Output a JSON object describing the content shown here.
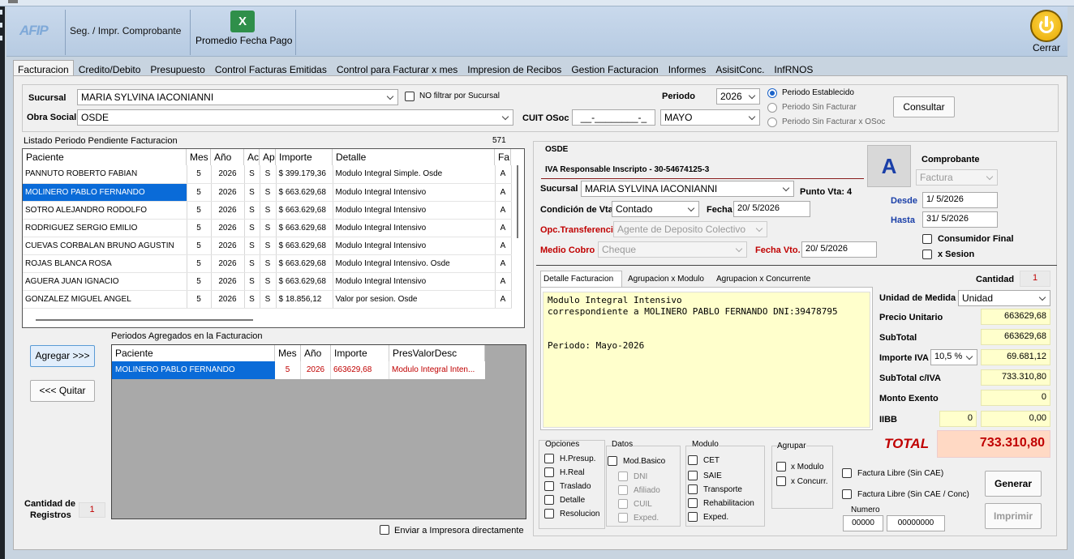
{
  "ribbon": {
    "seg_label": "Seg. / Impr. Comprobante",
    "promedio_label": "Promedio Fecha Pago",
    "cerrar_label": "Cerrar",
    "logo_text": "AFIP",
    "excel_text": "X"
  },
  "tabs": [
    "Facturacion",
    "Credito/Debito",
    "Presupuesto",
    "Control Facturas Emitidas",
    "Control para Facturar x mes",
    "Impresion de Recibos",
    "Gestion Facturacion",
    "Informes",
    "AsisitConc.",
    "InfRNOS"
  ],
  "filter": {
    "sucursal_label": "Sucursal",
    "sucursal_value": "MARIA SYLVINA IACONIANNI",
    "no_filtrar_label": "NO filtrar por Sucursal",
    "obra_social_label": "Obra Social",
    "obra_social_value": "OSDE",
    "cuit_label": "CUIT OSoc",
    "cuit_value": "__-________-_",
    "periodo_label": "Periodo",
    "year_value": "2026",
    "month_value": "MAYO",
    "radios": [
      "Periodo Establecido",
      "Periodo Sin Facturar",
      "Periodo Sin Facturar x OSoc"
    ],
    "consultar_label": "Consultar"
  },
  "listado": {
    "title": "Listado Periodo Pendiente Facturacion",
    "count": "571",
    "headers": [
      "Paciente",
      "Mes",
      "Año",
      "Ac",
      "Ap",
      "Importe",
      "Detalle",
      "Fa"
    ],
    "rows": [
      [
        "PANNUTO ROBERTO FABIAN",
        "5",
        "2026",
        "S",
        "S",
        "$ 399.179,36",
        "Modulo Integral Simple. Osde",
        "A"
      ],
      [
        "MOLINERO PABLO FERNANDO",
        "5",
        "2026",
        "S",
        "S",
        "$ 663.629,68",
        "Modulo Integral Intensivo",
        "A"
      ],
      [
        "SOTRO ALEJANDRO RODOLFO",
        "5",
        "2026",
        "S",
        "S",
        "$ 663.629,68",
        "Modulo Integral Intensivo",
        "A"
      ],
      [
        "RODRIGUEZ SERGIO EMILIO",
        "5",
        "2026",
        "S",
        "S",
        "$ 663.629,68",
        "Modulo Integral Intensivo",
        "A"
      ],
      [
        "CUEVAS CORBALAN BRUNO AGUSTIN",
        "5",
        "2026",
        "S",
        "S",
        "$ 663.629,68",
        "Modulo Integral Intensivo",
        "A"
      ],
      [
        "ROJAS BLANCA ROSA",
        "5",
        "2026",
        "S",
        "S",
        "$ 663.629,68",
        "Modulo Integral Intensivo. Osde",
        "A"
      ],
      [
        "AGUERA JUAN IGNACIO",
        "5",
        "2026",
        "S",
        "S",
        "$ 663.629,68",
        "Modulo Integral Intensivo",
        "A"
      ],
      [
        "GONZALEZ MIGUEL ANGEL",
        "5",
        "2026",
        "S",
        "S",
        "$ 18.856,12",
        "Valor por sesion. Osde",
        "A"
      ]
    ]
  },
  "agregados": {
    "title": "Periodos Agregados en la Facturacion",
    "headers": [
      "Paciente",
      "Mes",
      "Año",
      "Importe",
      "PresValorDesc"
    ],
    "rows": [
      [
        "MOLINERO PABLO FERNANDO",
        "5",
        "2026",
        "663629,68",
        "Modulo Integral Inten..."
      ]
    ]
  },
  "buttons": {
    "agregar": "Agregar >>>",
    "quitar": "<<< Quitar",
    "generar": "Generar",
    "imprimir": "Imprimir"
  },
  "cantidad_registros": {
    "label1": "Cantidad de",
    "label2": "Registros",
    "value": "1"
  },
  "enviar_label": "Enviar a Impresora directamente",
  "comp": {
    "os_name": "OSDE",
    "iva_line": "IVA Responsable Inscripto - 30-54674125-3",
    "letter": "A",
    "comprobante_label": "Comprobante",
    "comprobante_value": "Factura",
    "sucursal_label": "Sucursal",
    "sucursal_value": "MARIA SYLVINA IACONIANNI",
    "punto_vta": "Punto Vta: 4",
    "cond_label": "Condición de Vta.",
    "cond_value": "Contado",
    "fecha_label": "Fecha",
    "fecha_value": "20/ 5/2026",
    "opc_label": "Opc.Transferencia",
    "opc_value": "Agente de Deposito Colectivo",
    "medio_label": "Medio Cobro",
    "medio_value": "Cheque",
    "fvto_label": "Fecha Vto.",
    "fvto_value": "20/ 5/2026",
    "desde_label": "Desde",
    "desde_value": "1/ 5/2026",
    "hasta_label": "Hasta",
    "hasta_value": "31/ 5/2026",
    "consumidor_label": "Consumidor Final",
    "xsesion_label": "x Sesion"
  },
  "detalle": {
    "tabs": [
      "Detalle Facturacion",
      "Agrupacion x Modulo",
      "Agrupacion x Concurrente"
    ],
    "line1": "Modulo Integral Intensivo",
    "line2": "correspondiente a MOLINERO PABLO FERNANDO  DNI:39478795",
    "line3": "Periodo: Mayo-2026"
  },
  "totales": {
    "cantidad_label": "Cantidad",
    "cantidad_value": "1",
    "unidad_label": "Unidad de Medida",
    "unidad_value": "Unidad",
    "precio_label": "Precio Unitario",
    "precio_value": "663629,68",
    "subtotal_label": "SubTotal",
    "subtotal_value": "663629,68",
    "iva_label": "Importe IVA",
    "iva_rate": "10,5 %",
    "iva_value": "69.681,12",
    "subtotal_iva_label": "SubTotal c/IVA",
    "subtotal_iva_value": "733.310,80",
    "exento_label": "Monto Exento",
    "exento_value": "0",
    "iibb_label": "IIBB",
    "iibb_rate": "0",
    "iibb_value": "0,00",
    "total_label": "TOTAL",
    "total_value": "733.310,80"
  },
  "opciones": {
    "title": "Opciones",
    "items": [
      "H.Presup.",
      "H.Real",
      "Traslado",
      "Detalle",
      "Resolucion"
    ]
  },
  "datos": {
    "title": "Datos",
    "items": [
      "Mod.Basico",
      "DNI",
      "Afiliado",
      "CUIL",
      "Exped."
    ]
  },
  "modulo": {
    "title": "Modulo",
    "items": [
      "CET",
      "SAIE",
      "Transporte",
      "Rehabilitacion",
      "Exped."
    ]
  },
  "agrupar": {
    "title": "Agrupar",
    "items": [
      "x Modulo",
      "x Concurr."
    ]
  },
  "factura_libre": {
    "item1": "Factura Libre (Sin CAE)",
    "item2": "Factura Libre (Sin CAE / Conc)",
    "numero_label": "Numero",
    "numero1": "00000",
    "numero2": "00000000"
  },
  "colors": {
    "selection": "#0a6bd8",
    "total_red": "#c00000",
    "letter_blue": "#1a3fa8"
  }
}
